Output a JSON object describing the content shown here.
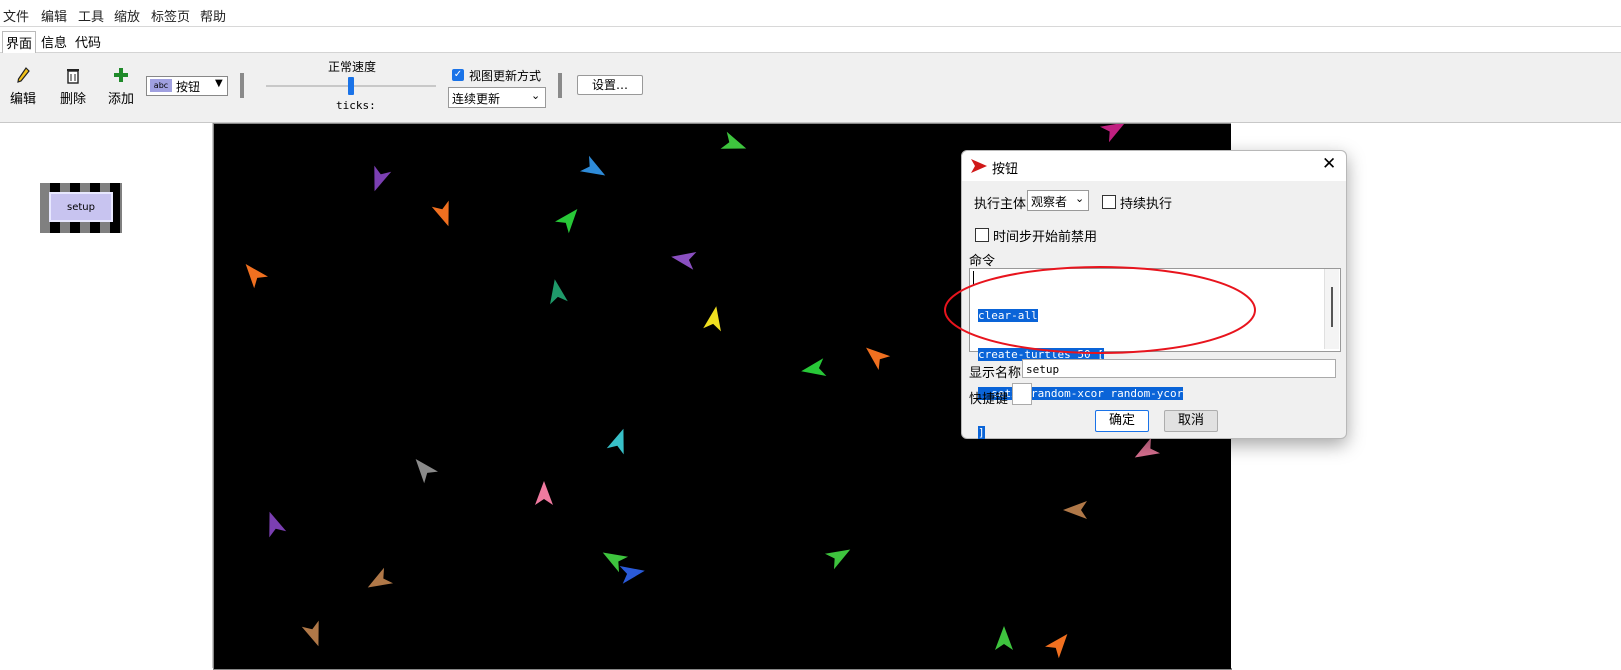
{
  "menu": [
    "文件",
    "编辑",
    "工具",
    "缩放",
    "标签页",
    "帮助"
  ],
  "tabs": [
    "界面",
    "信息",
    "代码"
  ],
  "toolbar": {
    "edit_label": "编辑",
    "delete_label": "删除",
    "add_label": "添加",
    "widget_type": "按钮",
    "widget_type_icon_text": "abc",
    "speed_label": "正常速度",
    "ticks_label": "ticks:",
    "view_update_label": "视图更新方式",
    "view_update_mode": "连续更新",
    "settings_label": "设置…"
  },
  "left_palette": {
    "button_label": "setup"
  },
  "dialog": {
    "title": "按钮",
    "agent_label": "执行主体",
    "agent_value": "观察者",
    "forever_label": "持续执行",
    "disable_label": "时间步开始前禁用",
    "commands_label": "命令",
    "code_lines": [
      "clear-all",
      "create-turtles 50 [",
      "  setxy random-xcor random-ycor",
      "]"
    ],
    "display_name_label": "显示名称",
    "display_name_value": "setup",
    "shortcut_label": "快捷键",
    "ok_label": "确定",
    "cancel_label": "取消"
  },
  "colors": {
    "selection": "#0a64d8",
    "annotation_ellipse": "#e8141d",
    "button_face": "#c8c4f0",
    "world_bg": "#000000"
  },
  "turtles": [
    {
      "color": "#7b3fb2"
    },
    {
      "color": "#2e8bd8"
    },
    {
      "color": "#3ec43e"
    },
    {
      "color": "#f07020"
    },
    {
      "color": "#28c838"
    },
    {
      "color": "#8a4fc0"
    },
    {
      "color": "#f07020"
    },
    {
      "color": "#1f9a6a"
    },
    {
      "color": "#f0e020"
    },
    {
      "color": "#28c838"
    },
    {
      "color": "#f07020"
    },
    {
      "color": "#38c0c8"
    },
    {
      "color": "#8a8a8a"
    },
    {
      "color": "#f07aa0"
    },
    {
      "color": "#7b3fb2"
    },
    {
      "color": "#3ec43e"
    },
    {
      "color": "#2a5ad8"
    },
    {
      "color": "#3ec43e"
    },
    {
      "color": "#b07848"
    },
    {
      "color": "#b07848"
    },
    {
      "color": "#d87090"
    },
    {
      "color": "#b07848"
    },
    {
      "color": "#c02080"
    },
    {
      "color": "#3ec43e"
    },
    {
      "color": "#f07020"
    }
  ]
}
